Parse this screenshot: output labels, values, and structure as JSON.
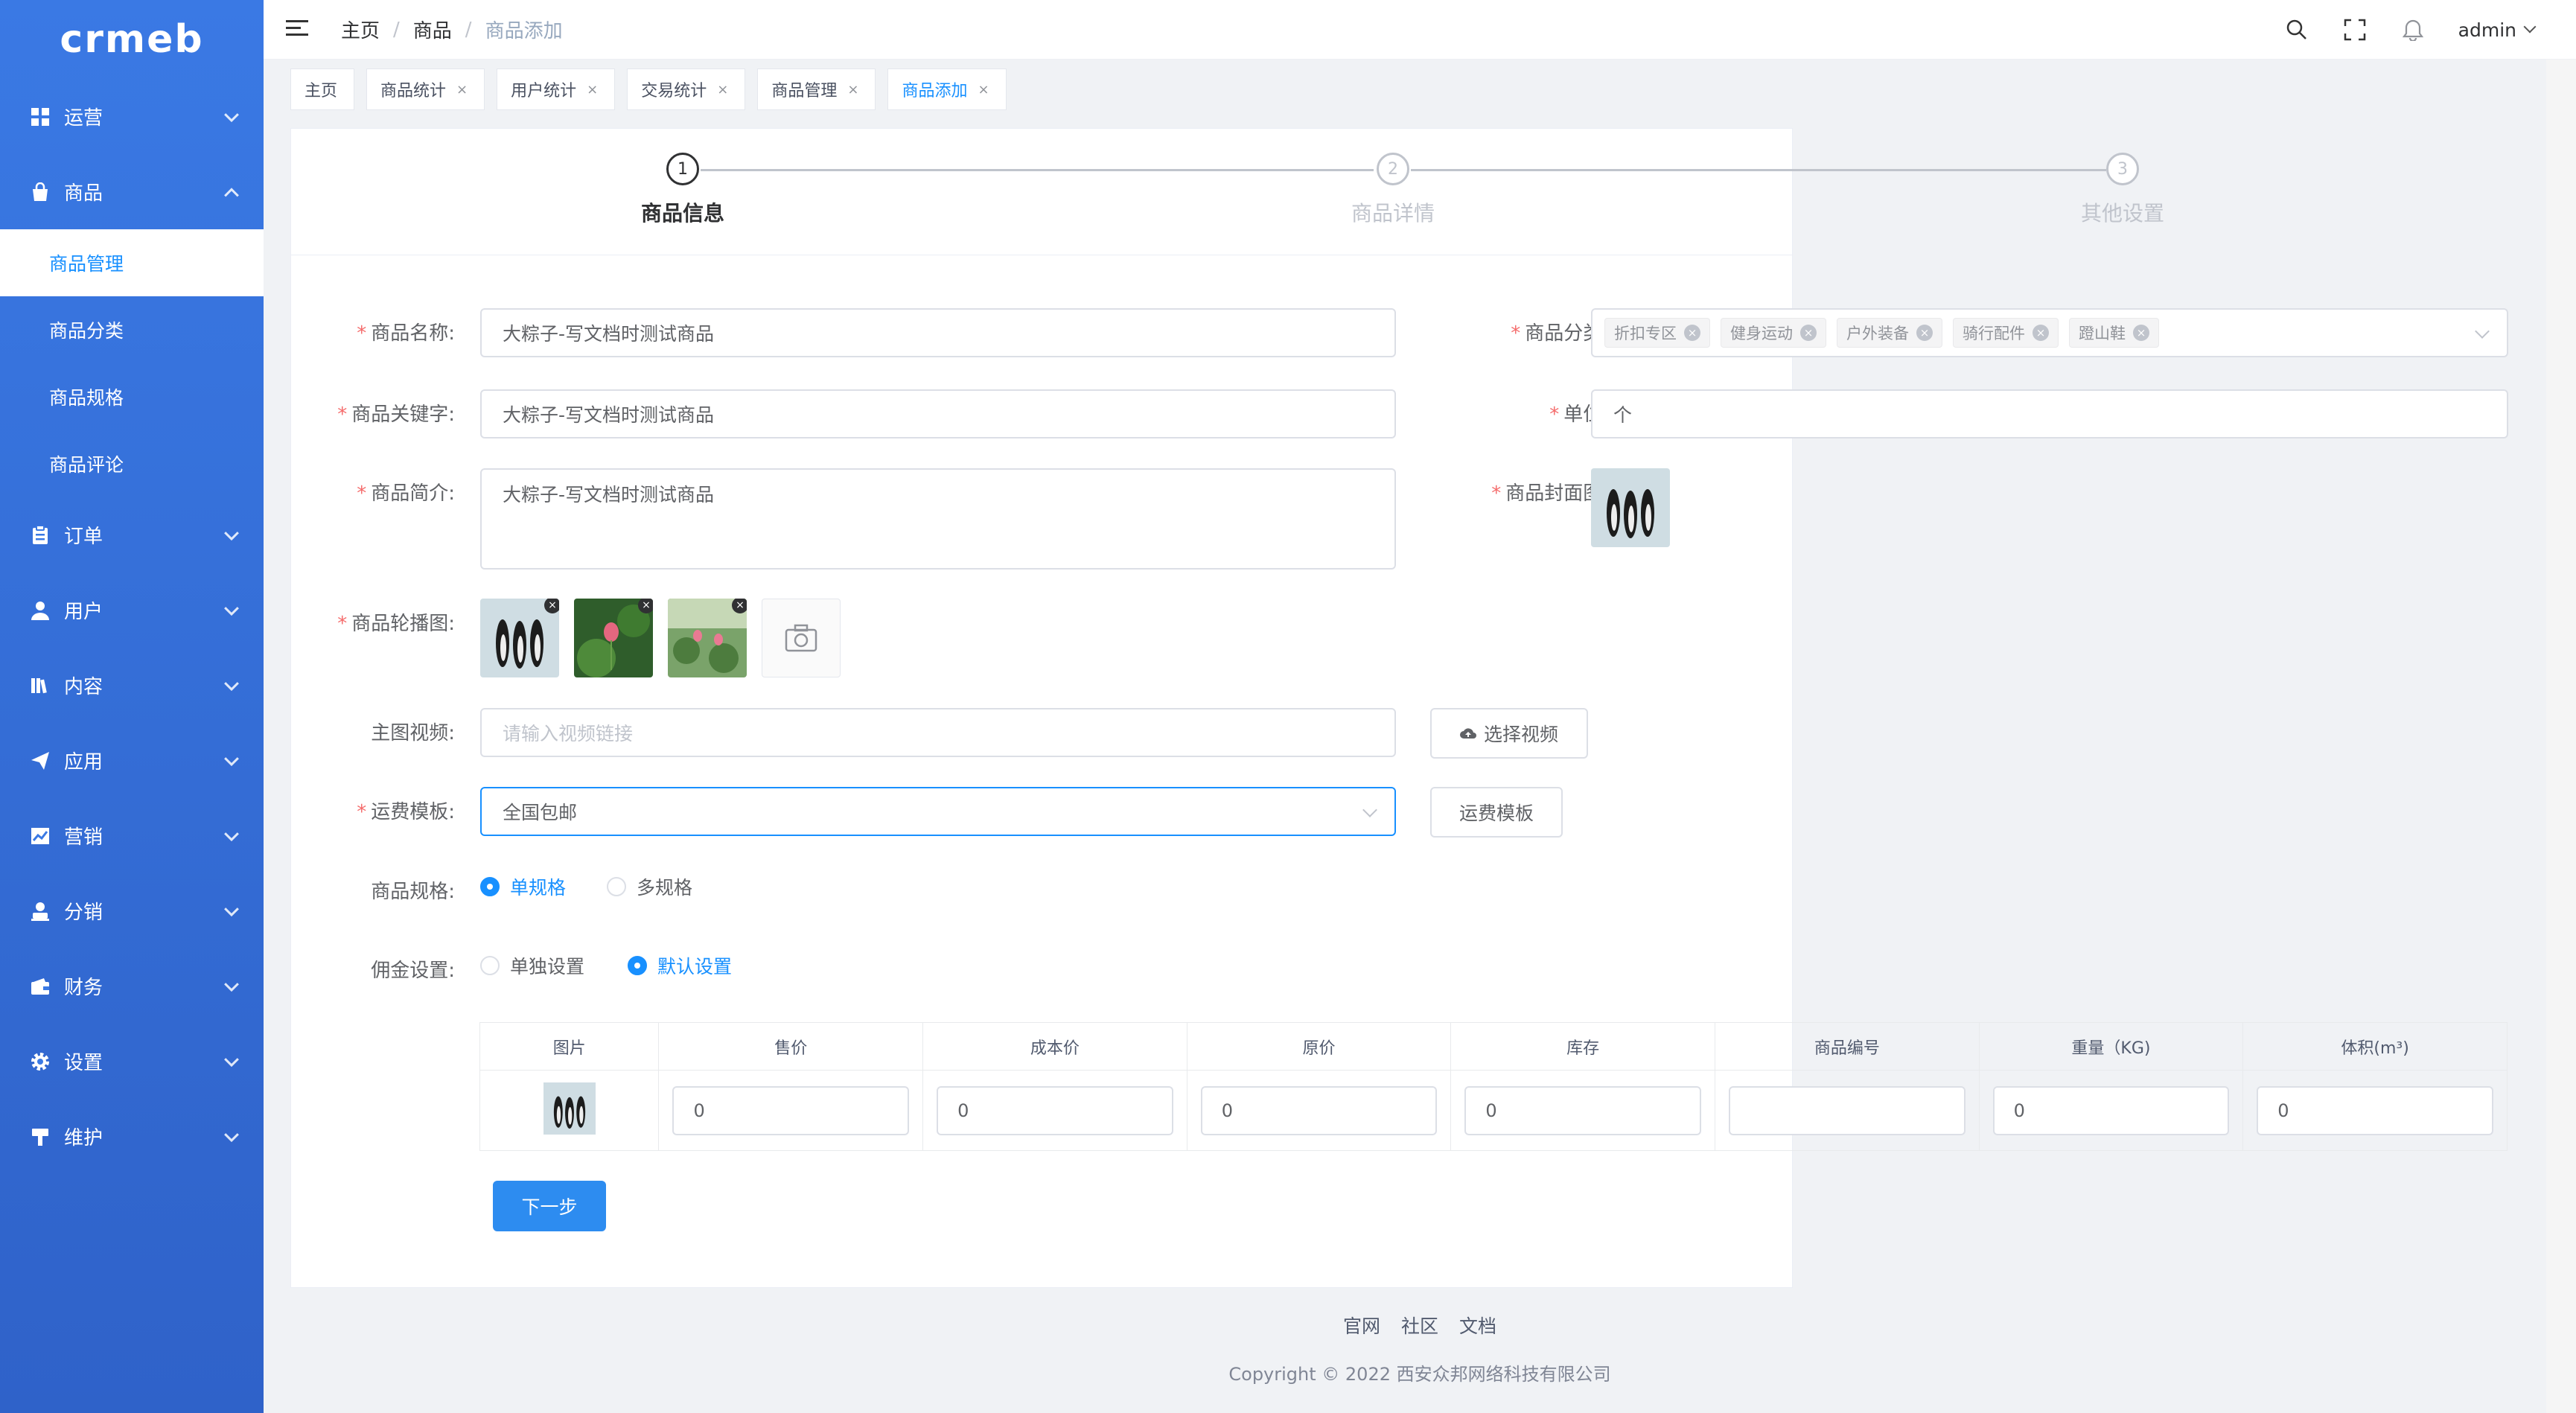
{
  "brand": {
    "logo_text": "crmeb",
    "primary": "#2d8cf0",
    "sidebar_bg": "#3a79e4"
  },
  "sidebar": {
    "items": [
      {
        "label": "运营",
        "icon": "grid-icon",
        "expanded": false
      },
      {
        "label": "商品",
        "icon": "bag-icon",
        "expanded": true,
        "children": [
          {
            "label": "商品管理",
            "active": true
          },
          {
            "label": "商品分类"
          },
          {
            "label": "商品规格"
          },
          {
            "label": "商品评论"
          }
        ]
      },
      {
        "label": "订单",
        "icon": "clipboard-icon"
      },
      {
        "label": "用户",
        "icon": "user-icon"
      },
      {
        "label": "内容",
        "icon": "book-icon"
      },
      {
        "label": "应用",
        "icon": "send-icon"
      },
      {
        "label": "营销",
        "icon": "chart-icon"
      },
      {
        "label": "分销",
        "icon": "person-icon"
      },
      {
        "label": "财务",
        "icon": "wallet-icon"
      },
      {
        "label": "设置",
        "icon": "gear-icon"
      },
      {
        "label": "维护",
        "icon": "hammer-icon"
      }
    ]
  },
  "header": {
    "breadcrumb": [
      "主页",
      "商品",
      "商品添加"
    ],
    "user": "admin"
  },
  "tabs": [
    {
      "label": "主页",
      "closable": false
    },
    {
      "label": "商品统计",
      "closable": true
    },
    {
      "label": "用户统计",
      "closable": true
    },
    {
      "label": "交易统计",
      "closable": true
    },
    {
      "label": "商品管理",
      "closable": true
    },
    {
      "label": "商品添加",
      "closable": true,
      "active": true
    }
  ],
  "steps": [
    {
      "num": "1",
      "title": "商品信息",
      "status": "current"
    },
    {
      "num": "2",
      "title": "商品详情",
      "status": "wait"
    },
    {
      "num": "3",
      "title": "其他设置",
      "status": "wait"
    }
  ],
  "form": {
    "name": {
      "label": "商品名称:",
      "value": "大粽子-写文档时测试商品"
    },
    "keyword": {
      "label": "商品关键字:",
      "value": "大粽子-写文档时测试商品"
    },
    "intro": {
      "label": "商品简介:",
      "value": "大粽子-写文档时测试商品"
    },
    "category": {
      "label": "商品分类:",
      "tags": [
        "折扣专区",
        "健身运动",
        "户外装备",
        "骑行配件",
        "蹬山鞋"
      ]
    },
    "unit": {
      "label": "单位:",
      "value": "个"
    },
    "cover": {
      "label": "商品封面图:"
    },
    "carousel": {
      "label": "商品轮播图:"
    },
    "video": {
      "label": "主图视频:",
      "placeholder": "请输入视频链接",
      "button": "选择视频"
    },
    "shipping": {
      "label": "运费模板:",
      "value": "全国包邮",
      "button": "运费模板"
    },
    "spec": {
      "label": "商品规格:",
      "options": [
        "单规格",
        "多规格"
      ],
      "selected": "单规格"
    },
    "commission": {
      "label": "佣金设置:",
      "options": [
        "单独设置",
        "默认设置"
      ],
      "selected": "默认设置"
    }
  },
  "spec_table": {
    "headers": [
      "图片",
      "售价",
      "成本价",
      "原价",
      "库存",
      "商品编号",
      "重量（KG)",
      "体积(m³)"
    ],
    "row": [
      "",
      "0",
      "0",
      "0",
      "0",
      "",
      "0",
      "0"
    ]
  },
  "next_button": "下一步",
  "footer": {
    "links": [
      "官网",
      "社区",
      "文档"
    ],
    "copyright": "Copyright © 2022 西安众邦网络科技有限公司"
  }
}
